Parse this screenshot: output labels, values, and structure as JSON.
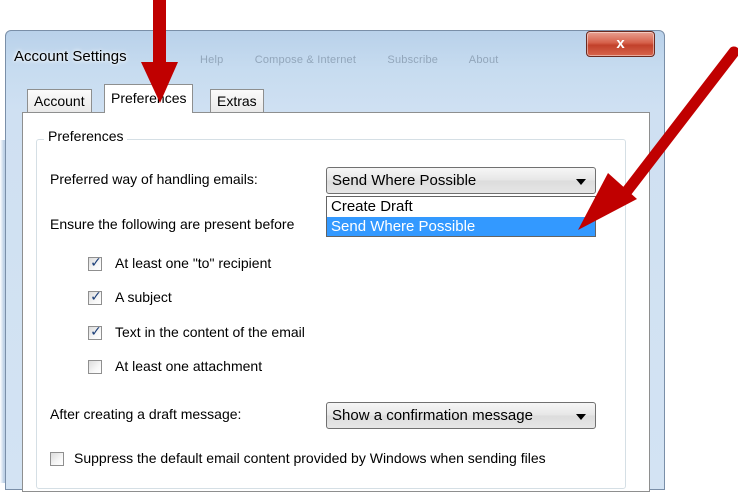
{
  "window": {
    "title": "Account Settings",
    "close_glyph": "x",
    "background_menu": [
      "Help",
      "Compose & Internet",
      "Subscribe",
      "About"
    ]
  },
  "tabs": [
    {
      "label": "Account",
      "active": false
    },
    {
      "label": "Preferences",
      "active": true
    },
    {
      "label": "Extras",
      "active": false
    }
  ],
  "preferences": {
    "group_label": "Preferences",
    "handling_label": "Preferred way of handling emails:",
    "handling_value": "Send Where Possible",
    "handling_options": [
      "Create Draft",
      "Send Where Possible"
    ],
    "handling_highlighted": "Send Where Possible",
    "ensure_label": "Ensure the following are present before",
    "checks": [
      {
        "label": "At least one \"to\" recipient",
        "checked": true
      },
      {
        "label": "A subject",
        "checked": true
      },
      {
        "label": "Text in the content of the email",
        "checked": true
      },
      {
        "label": "At least one attachment",
        "checked": false
      }
    ],
    "after_label": "After creating a draft message:",
    "after_value": "Show a confirmation message",
    "suppress_label": "Suppress the default email content provided by Windows when sending files",
    "suppress_checked": false
  },
  "colors": {
    "annotation_arrow": "#c00000",
    "selection": "#3399ff",
    "close_button": "#c2412b"
  },
  "icons": {
    "close": "close-icon",
    "dropdown": "chevron-down-icon",
    "check": "checkmark-icon"
  }
}
